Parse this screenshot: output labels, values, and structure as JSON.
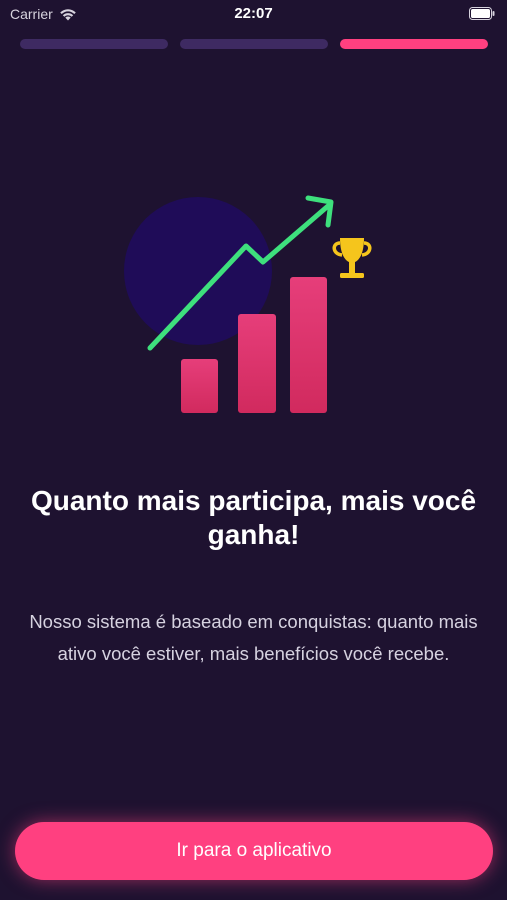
{
  "status_bar": {
    "carrier": "Carrier",
    "time": "22:07"
  },
  "progress": {
    "total_steps": 3,
    "current_step": 3
  },
  "onboarding": {
    "title": "Quanto mais participa, mais você ganha!",
    "description": "Nosso sistema é baseado em conquistas: quanto mais ativo você estiver, mais benefícios você recebe.",
    "cta_label": "Ir para o aplicativo"
  },
  "colors": {
    "background": "#1e1230",
    "accent": "#ff4080",
    "progress_inactive": "#3e2a62",
    "arrow": "#3ee07d",
    "circle": "#1f0c58",
    "trophy": "#f5c51c"
  },
  "icons": [
    "wifi-icon",
    "battery-icon",
    "growth-chart-icon",
    "trophy-icon"
  ]
}
